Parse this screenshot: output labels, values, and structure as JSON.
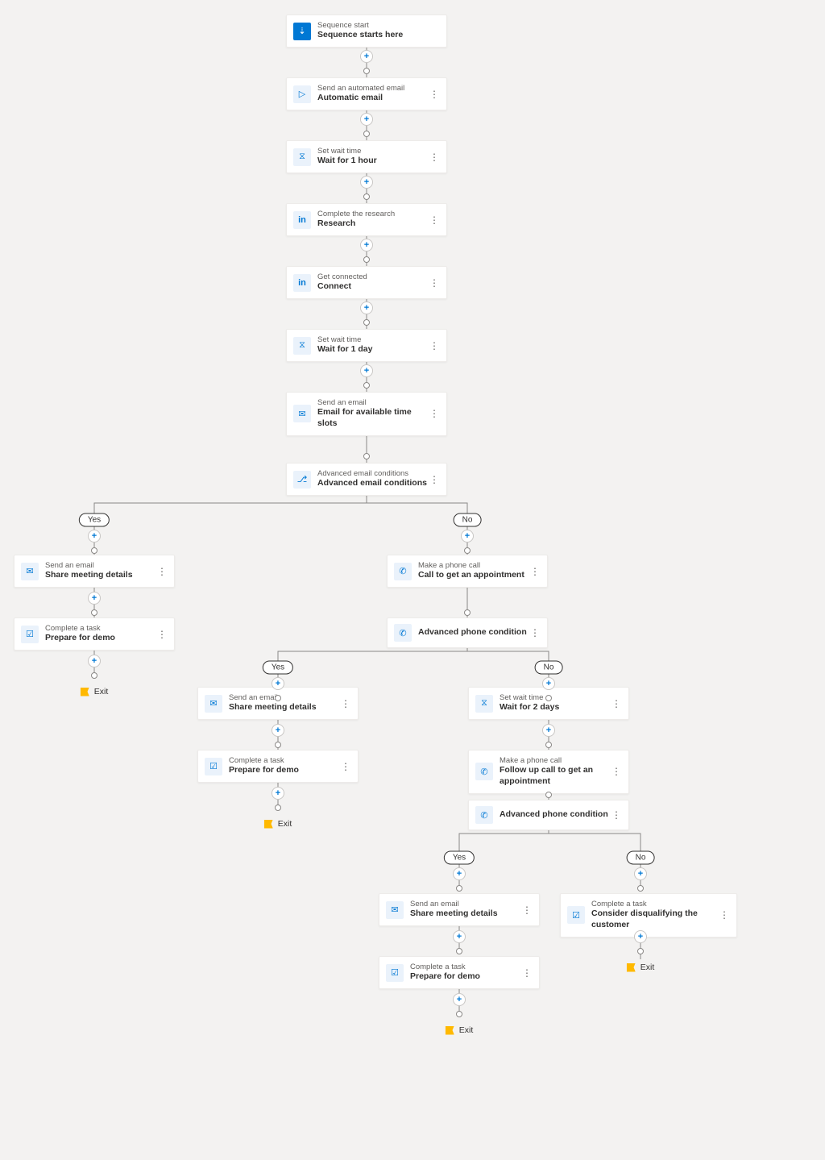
{
  "labels": {
    "yes": "Yes",
    "no": "No",
    "exit": "Exit"
  },
  "nodes": {
    "n0": {
      "subtitle": "Sequence start",
      "title": "Sequence starts here"
    },
    "n1": {
      "subtitle": "Send an automated email",
      "title": "Automatic email"
    },
    "n2": {
      "subtitle": "Set wait time",
      "title": "Wait for 1 hour"
    },
    "n3": {
      "subtitle": "Complete the research",
      "title": "Research"
    },
    "n4": {
      "subtitle": "Get connected",
      "title": "Connect"
    },
    "n5": {
      "subtitle": "Set wait time",
      "title": "Wait for 1 day"
    },
    "n6": {
      "subtitle": "Send an email",
      "title": "Email for available time slots"
    },
    "n7": {
      "subtitle": "Advanced email conditions",
      "title": "Advanced email conditions"
    },
    "n8": {
      "subtitle": "Send an email",
      "title": "Share meeting details"
    },
    "n9": {
      "subtitle": "Complete a task",
      "title": "Prepare for demo"
    },
    "n10": {
      "subtitle": "Make a phone call",
      "title": "Call to get an appointment"
    },
    "n11": {
      "subtitle": "",
      "title": "Advanced phone condition"
    },
    "n12": {
      "subtitle": "Send an email",
      "title": "Share meeting details"
    },
    "n13": {
      "subtitle": "Complete a task",
      "title": "Prepare for demo"
    },
    "n14": {
      "subtitle": "Set wait time",
      "title": "Wait for 2 days"
    },
    "n15": {
      "subtitle": "Make a phone call",
      "title": "Follow up call to get an appointment"
    },
    "n16": {
      "subtitle": "",
      "title": "Advanced phone condition"
    },
    "n17": {
      "subtitle": "Send an email",
      "title": "Share meeting details"
    },
    "n18": {
      "subtitle": "Complete a task",
      "title": "Prepare for demo"
    },
    "n19": {
      "subtitle": "Complete a task",
      "title": "Consider disqualifying the customer"
    }
  },
  "icons": {
    "start": "•",
    "send": "▷",
    "hourglass": "⌛",
    "linkedin": "in",
    "mail": "✉",
    "branch": "⎇",
    "phone": "✆",
    "check": "☑"
  }
}
